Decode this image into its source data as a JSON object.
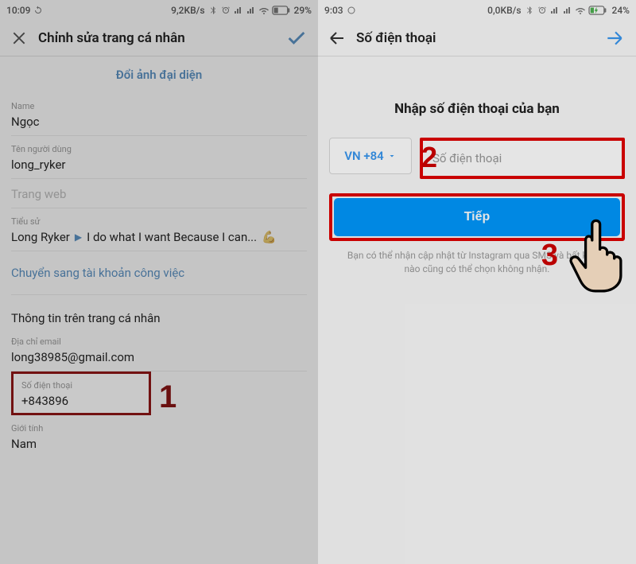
{
  "left": {
    "status": {
      "time": "10:09",
      "rate": "9,2KB/s",
      "battery": "29%"
    },
    "header": {
      "title": "Chỉnh sửa trang cá nhân"
    },
    "change_photo": "Đổi ảnh đại diện",
    "fields": {
      "name_label": "Name",
      "name_value": "Ngọc",
      "username_label": "Tên người dùng",
      "username_value": "long_ryker",
      "website_label": "Trang web",
      "bio_label": "Tiểu sử",
      "bio_name": "Long Ryker",
      "bio_text": "I do what I want Because I can...",
      "switch_link": "Chuyển sang tài khoản công việc",
      "profile_section": "Thông tin trên trang cá nhân",
      "email_label": "Địa chỉ email",
      "email_value": "long38985@gmail.com",
      "phone_label": "Số điện thoại",
      "phone_value": "+843896",
      "gender_label": "Giới tính",
      "gender_value": "Nam"
    },
    "badge": "1"
  },
  "right": {
    "status": {
      "time": "9:03",
      "rate": "0,0KB/s",
      "battery": "24%"
    },
    "header": {
      "title": "Số điện thoại"
    },
    "heading": "Nhập số điện thoại của bạn",
    "country": "VN +84",
    "phone_placeholder": "Số điện thoại",
    "next_btn": "Tiếp",
    "helper_line1": "Bạn có thể nhận cập nhật từ Instagram qua SMS và bất kỳ lúc",
    "helper_line2": "nào cũng có thể chọn không nhận.",
    "badge2": "2",
    "badge3": "3"
  }
}
